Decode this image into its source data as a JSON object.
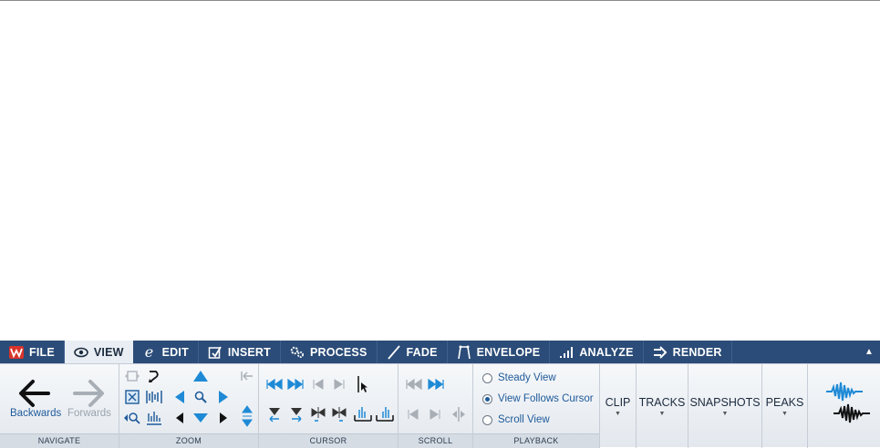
{
  "tabs": [
    {
      "label": "FILE",
      "icon": "wavelab-logo-icon",
      "active": false
    },
    {
      "label": "VIEW",
      "icon": "eye-icon",
      "active": true
    },
    {
      "label": "EDIT",
      "icon": "edit-e-icon",
      "active": false
    },
    {
      "label": "INSERT",
      "icon": "insert-icon",
      "active": false
    },
    {
      "label": "PROCESS",
      "icon": "gears-icon",
      "active": false
    },
    {
      "label": "FADE",
      "icon": "fade-line-icon",
      "active": false
    },
    {
      "label": "ENVELOPE",
      "icon": "envelope-icon",
      "active": false
    },
    {
      "label": "ANALYZE",
      "icon": "bars-icon",
      "active": false
    },
    {
      "label": "RENDER",
      "icon": "render-arrow-icon",
      "active": false
    }
  ],
  "groups": {
    "navigate": {
      "label": "NAVIGATE",
      "backwards": "Backwards",
      "forwards": "Forwards"
    },
    "zoom": {
      "label": "ZOOM"
    },
    "cursor": {
      "label": "CURSOR"
    },
    "scroll": {
      "label": "SCROLL"
    },
    "playback": {
      "label": "PLAYBACK",
      "options": [
        "Steady View",
        "View Follows Cursor",
        "Scroll View"
      ],
      "selected": "View Follows Cursor"
    }
  },
  "menus": {
    "clip": "CLIP",
    "tracks": "TRACKS",
    "snapshots": "SNAPSHOTS",
    "peaks": "PEAKS"
  },
  "colors": {
    "tabbar": "#2b4c78",
    "accent": "#1e8ad6",
    "label_text": "#1e5a9a"
  }
}
